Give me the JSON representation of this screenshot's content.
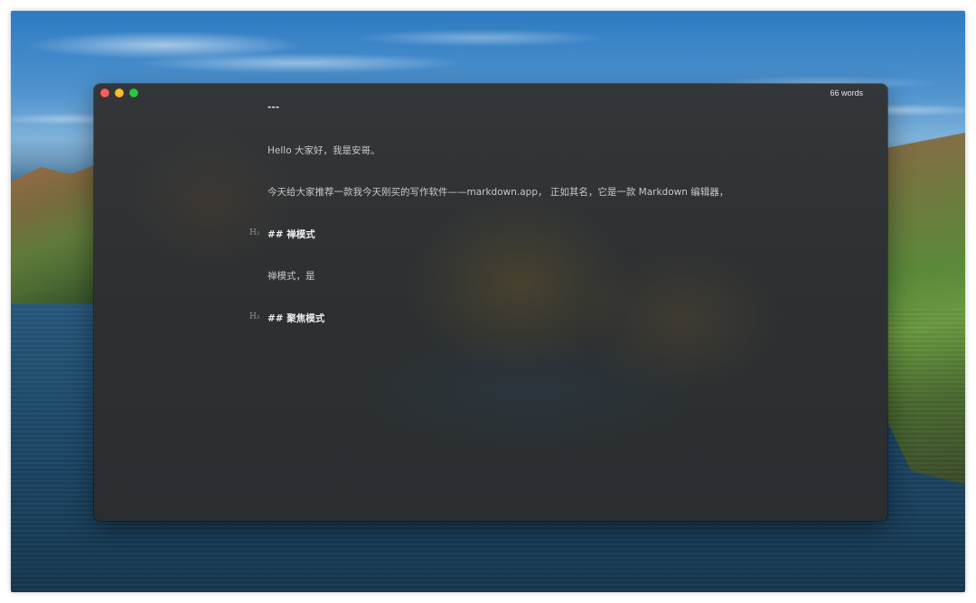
{
  "window": {
    "word_count": "66 words",
    "controls": {
      "close": "close-button",
      "minimize": "minimize-button",
      "zoom": "zoom-button"
    }
  },
  "editor": {
    "lines": [
      {
        "type": "hr",
        "text": "---"
      },
      {
        "type": "paragraph",
        "text": "Hello 大家好，我是安哥。"
      },
      {
        "type": "paragraph",
        "text": "今天给大家推荐一款我今天刚买的写作软件——markdown.app， 正如其名，它是一款 Markdown 编辑器，"
      },
      {
        "type": "heading",
        "gutter": "H₂",
        "text": "## 禅模式"
      },
      {
        "type": "paragraph",
        "text": "禅模式，是"
      },
      {
        "type": "heading",
        "gutter": "H₂",
        "text": "## 聚焦模式"
      }
    ]
  }
}
